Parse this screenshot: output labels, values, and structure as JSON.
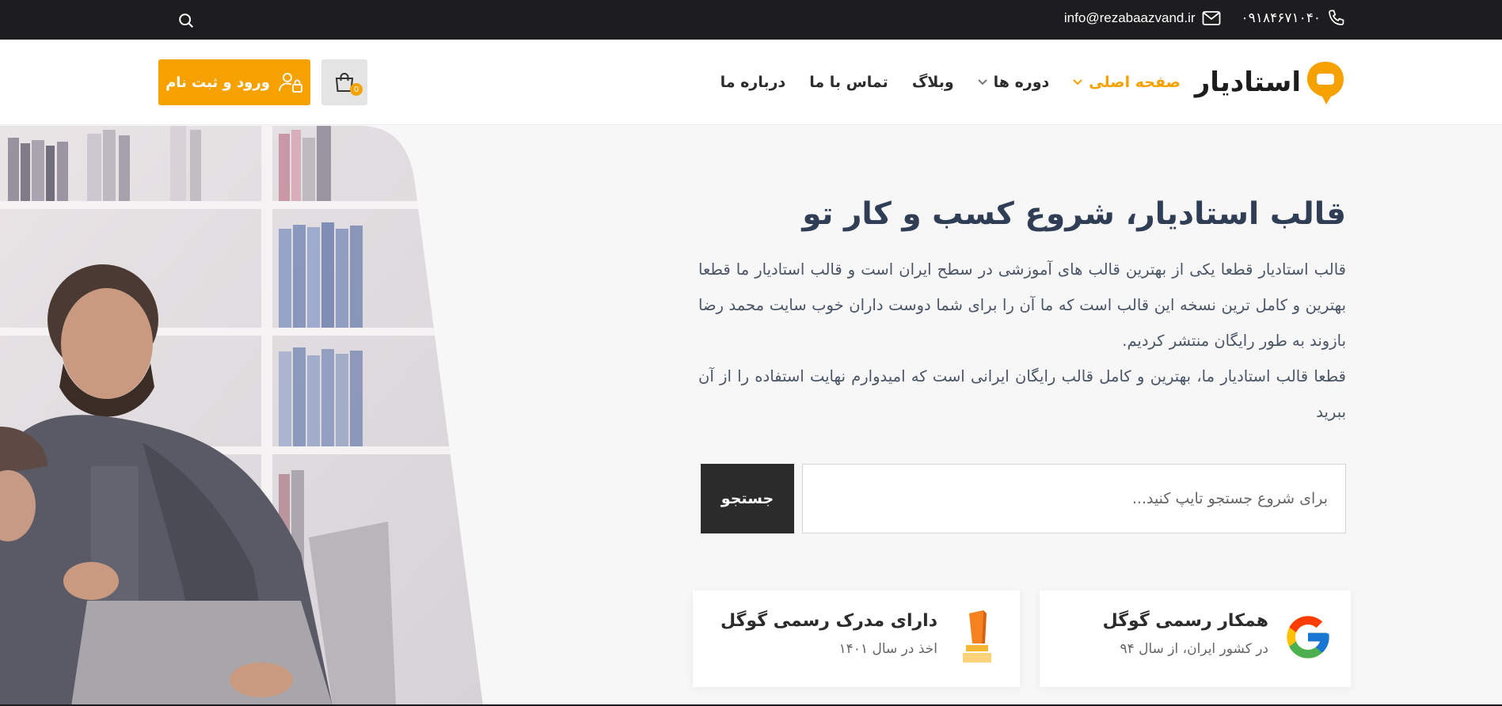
{
  "topbar": {
    "phone": "۰۹۱۸۴۶۷۱۰۴۰",
    "email": "info@rezabaazvand.ir",
    "icons": {
      "search": "search-icon",
      "phone": "phone-icon",
      "email": "mail-icon"
    }
  },
  "header": {
    "logo_text": "استادیار",
    "nav": [
      {
        "label": "صفحه اصلی",
        "active": true,
        "dropdown": true
      },
      {
        "label": "دوره ها",
        "active": false,
        "dropdown": true
      },
      {
        "label": "وبلاگ",
        "active": false,
        "dropdown": false
      },
      {
        "label": "تماس با ما",
        "active": false,
        "dropdown": false
      },
      {
        "label": "درباره ما",
        "active": false,
        "dropdown": false
      }
    ],
    "cart_badge": "0",
    "login_label": "ورود و ثبت نام"
  },
  "hero": {
    "title": "قالب استادیار، شروع کسب و کار تو",
    "description": "قالب استادیار قطعا یکی از بهترین قالب های آموزشی در سطح ایران است و قالب استادیار ما قطعا بهترین و کامل ترین نسخه این قالب است که ما آن را برای شما دوست داران خوب سایت محمد رضا بازوند به طور رایگان منتشر کردیم.",
    "description2": "قطعا قالب استادیار ما، بهترین و کامل قالب رایگان ایرانی است که امیدوارم نهایت استفاده را از آن ببرید"
  },
  "search": {
    "placeholder": "برای شروع جستجو تایپ کنید...",
    "button_label": "جستجو"
  },
  "features": [
    {
      "title": "همکار رسمی گوگل",
      "subtitle": "در کشور ایران، از سال ۹۴",
      "icon": "google-icon"
    },
    {
      "title": "دارای مدرک رسمی گوگل",
      "subtitle": "اخذ در سال ۱۴۰۱",
      "icon": "trophy-icon"
    }
  ],
  "colors": {
    "accent": "#f5a100",
    "dark": "#1d1d1f",
    "title": "#2f3e55"
  }
}
